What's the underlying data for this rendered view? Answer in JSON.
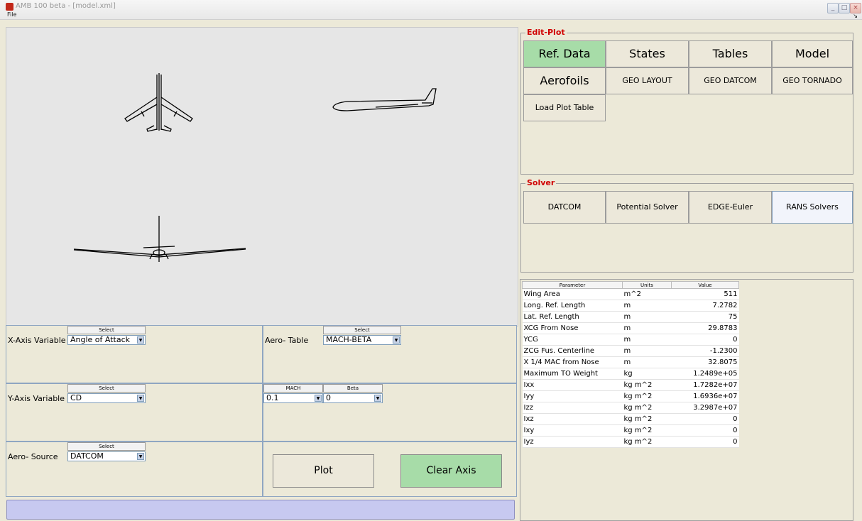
{
  "window": {
    "title": "AMB 100 beta - [model.xml]"
  },
  "menu": {
    "file": "File"
  },
  "axes_controls": {
    "x_axis": {
      "header": "Select",
      "label": "X-Axis Variable",
      "value": "Angle of Attack"
    },
    "y_axis": {
      "header": "Select",
      "label": "Y-Axis Variable",
      "value": "CD"
    },
    "aero_source": {
      "header": "Select",
      "label": "Aero- Source",
      "value": "DATCOM"
    },
    "aero_table": {
      "header": "Select",
      "label": "Aero- Table",
      "value": "MACH-BETA"
    },
    "mach": {
      "header": "MACH",
      "value": "0.1"
    },
    "beta": {
      "header": "Beta",
      "value": "0"
    }
  },
  "buttons": {
    "plot": "Plot",
    "clear_axis": "Clear Axis"
  },
  "edit_plot": {
    "title": "Edit-Plot",
    "row1": [
      "Ref. Data",
      "States",
      "Tables",
      "Model"
    ],
    "row2": [
      "Aerofoils",
      "GEO LAYOUT",
      "GEO DATCOM",
      "GEO TORNADO"
    ],
    "load_plot_table": "Load Plot Table"
  },
  "solver": {
    "title": "Solver",
    "buttons": [
      "DATCOM",
      "Potential Solver",
      "EDGE-Euler",
      "RANS Solvers"
    ]
  },
  "param_table": {
    "headers": [
      "Parameter",
      "Units",
      "Value"
    ],
    "rows": [
      [
        "Wing Area",
        "m^2",
        "511"
      ],
      [
        "Long. Ref. Length",
        "m",
        "7.2782"
      ],
      [
        "Lat. Ref. Length",
        "m",
        "75"
      ],
      [
        "XCG From Nose",
        "m",
        "29.8783"
      ],
      [
        "YCG",
        "m",
        "0"
      ],
      [
        "ZCG Fus. Centerline",
        "m",
        "-1.2300"
      ],
      [
        "X 1/4 MAC from Nose",
        "m",
        "32.8075"
      ],
      [
        "Maximum TO Weight",
        "kg",
        "1.2489e+05"
      ],
      [
        "Ixx",
        "kg m^2",
        "1.7282e+07"
      ],
      [
        "Iyy",
        "kg m^2",
        "1.6936e+07"
      ],
      [
        "Izz",
        "kg m^2",
        "3.2987e+07"
      ],
      [
        "Ixz",
        "kg m^2",
        "0"
      ],
      [
        "Ixy",
        "kg m^2",
        "0"
      ],
      [
        "Iyz",
        "kg m^2",
        "0"
      ]
    ]
  },
  "colors": {
    "active_green": "#a7dca8",
    "status_bar": "#c7c9f0",
    "group_title": "#d00000"
  }
}
